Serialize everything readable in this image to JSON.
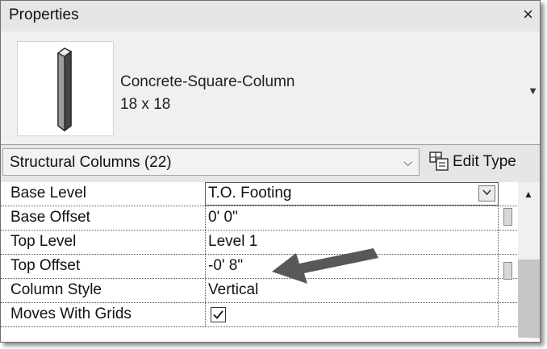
{
  "panel": {
    "title": "Properties",
    "close_glyph": "×"
  },
  "type_selector": {
    "name": "Concrete-Square-Column",
    "size": "18 x 18",
    "dropdown_glyph": "▼",
    "thumbnail_icon": "column-thumbnail-icon"
  },
  "filter": {
    "label": "Structural Columns (22)",
    "chevron": "⌵",
    "edit_type_label": "Edit Type",
    "edit_type_icon": "edit-type-icon"
  },
  "properties": [
    {
      "label": "Base Level",
      "value": "T.O. Footing",
      "editor": "dropdown"
    },
    {
      "label": "Base Offset",
      "value": "0'  0\""
    },
    {
      "label": "Top Level",
      "value": "Level 1"
    },
    {
      "label": "Top Offset",
      "value": "-0'  8\""
    },
    {
      "label": "Column Style",
      "value": "Vertical"
    },
    {
      "label": "Moves With Grids",
      "value": "✓",
      "editor": "checkbox",
      "checked": true
    }
  ],
  "scrollbar": {
    "up_glyph": "▲"
  },
  "colors": {
    "panel_bg": "#ffffff",
    "header_bg": "#e6e6e6",
    "arrow": "#585858"
  }
}
